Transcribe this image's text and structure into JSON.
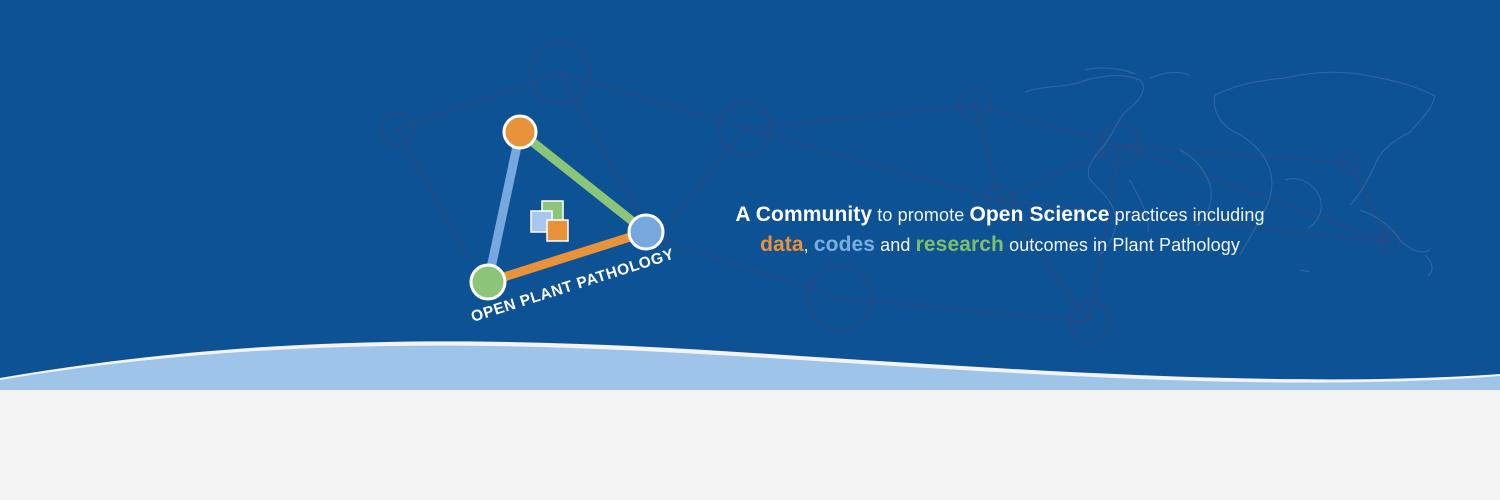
{
  "logo": {
    "text": "OPEN PLANT PATHOLOGY",
    "colors": {
      "orange": "#e8923a",
      "green": "#8cc57a",
      "blue": "#76a8dd"
    }
  },
  "tagline": {
    "line1": {
      "a_community": "A Community",
      "to_promote": " to promote ",
      "open_science": "Open Science",
      "practices": " practices including"
    },
    "line2": {
      "data": "data",
      "comma": ", ",
      "codes": "codes",
      "and": " and ",
      "research": "research",
      "outcomes": " outcomes in Plant Pathology"
    }
  },
  "colors": {
    "background_blue": "#0e5296",
    "wave_light_blue": "#9ec4ea",
    "page_background": "#f3f3f3"
  }
}
